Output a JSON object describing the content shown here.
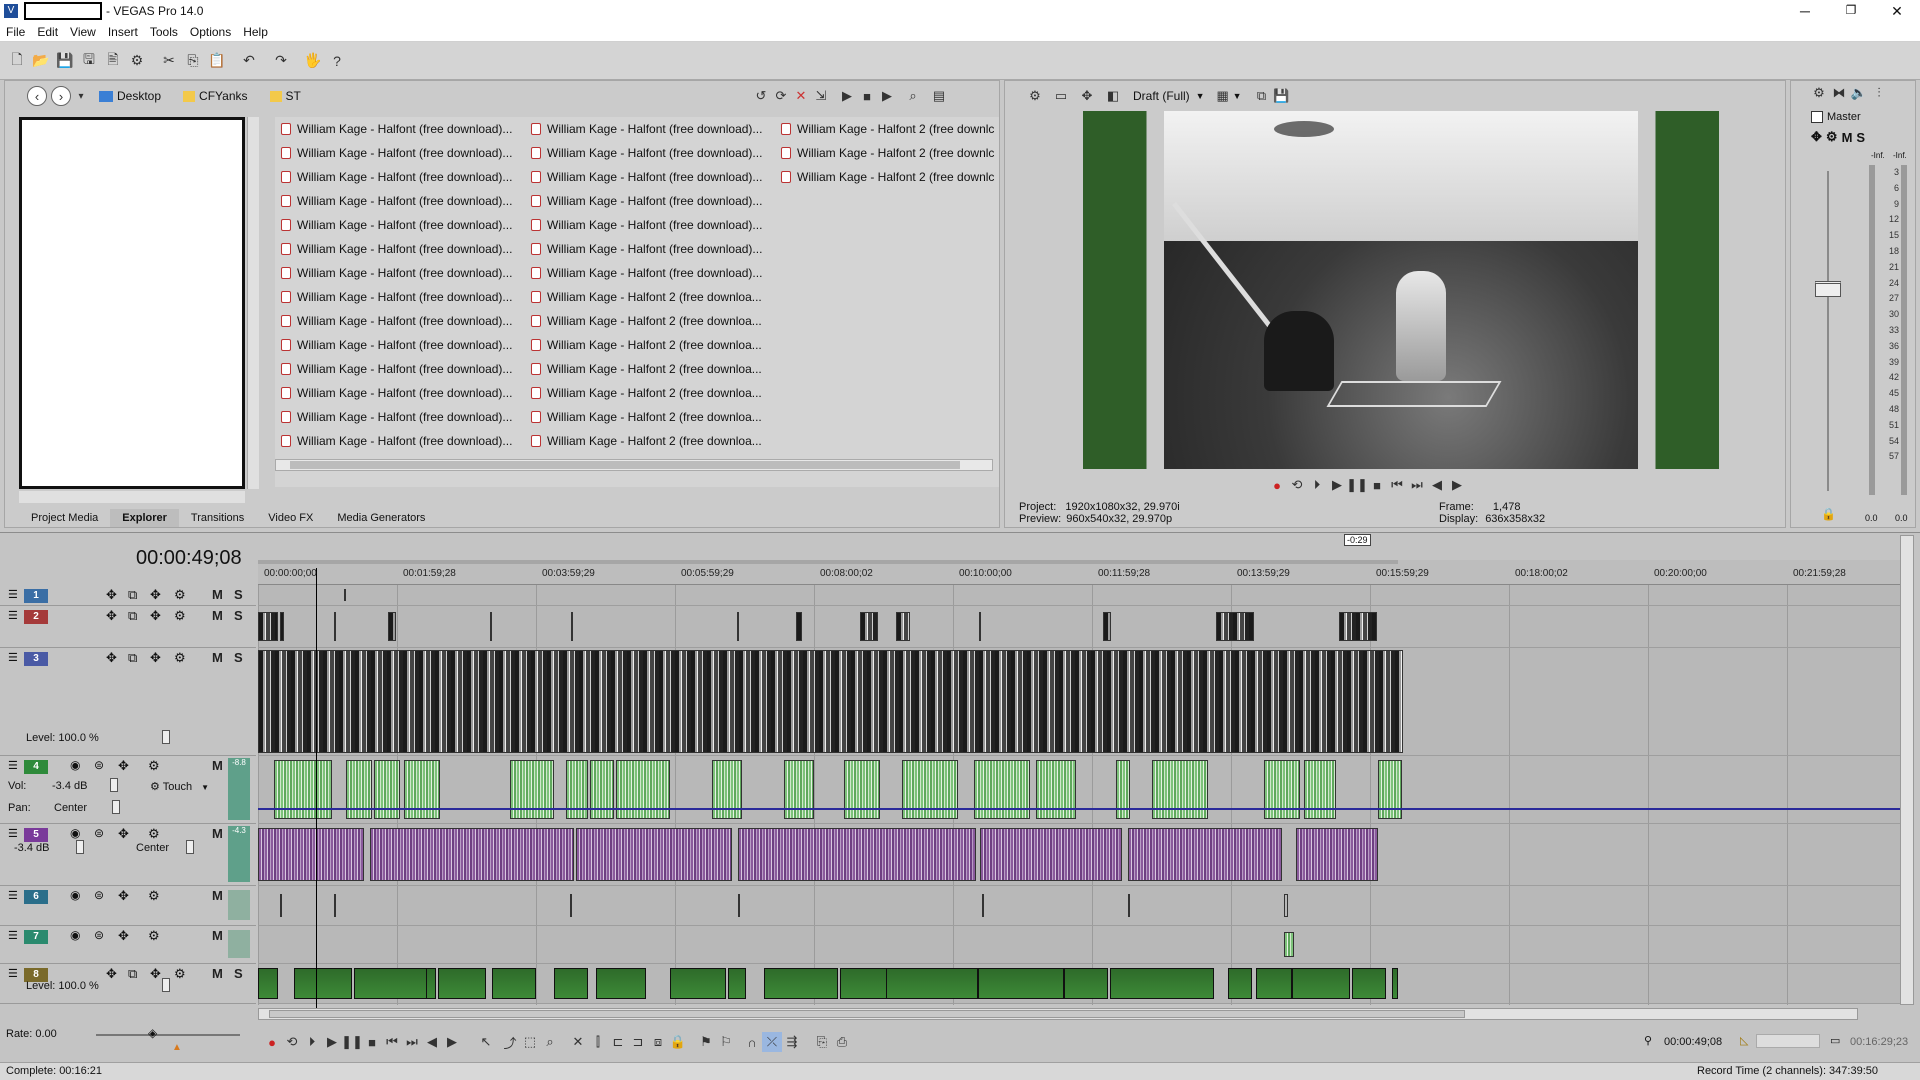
{
  "window": {
    "title": "- VEGAS Pro 14.0"
  },
  "menu": [
    "File",
    "Edit",
    "View",
    "Insert",
    "Tools",
    "Options",
    "Help"
  ],
  "explorer": {
    "breadcrumb": [
      "Desktop",
      "CFYanks",
      "ST"
    ],
    "col1": [
      "William Kage - Halfont (free download)...",
      "William Kage - Halfont (free download)...",
      "William Kage - Halfont (free download)...",
      "William Kage - Halfont (free download)...",
      "William Kage - Halfont (free download)...",
      "William Kage - Halfont (free download)...",
      "William Kage - Halfont (free download)...",
      "William Kage - Halfont (free download)...",
      "William Kage - Halfont (free download)...",
      "William Kage - Halfont (free download)...",
      "William Kage - Halfont (free download)...",
      "William Kage - Halfont (free download)...",
      "William Kage - Halfont (free download)...",
      "William Kage - Halfont (free download)..."
    ],
    "col2": [
      "William Kage - Halfont (free download)...",
      "William Kage - Halfont (free download)...",
      "William Kage - Halfont (free download)...",
      "William Kage - Halfont (free download)...",
      "William Kage - Halfont (free download)...",
      "William Kage - Halfont (free download)...",
      "William Kage - Halfont (free download)...",
      "William Kage - Halfont 2 (free downloa...",
      "William Kage - Halfont 2 (free downloa...",
      "William Kage - Halfont 2 (free downloa...",
      "William Kage - Halfont 2 (free downloa...",
      "William Kage - Halfont 2 (free downloa...",
      "William Kage - Halfont 2 (free downloa...",
      "William Kage - Halfont 2 (free downloa..."
    ],
    "col3": [
      "William Kage - Halfont 2 (free downlc",
      "William Kage - Halfont 2 (free downlc",
      "William Kage - Halfont 2 (free downlc"
    ],
    "tabs": [
      "Project Media",
      "Explorer",
      "Transitions",
      "Video FX",
      "Media Generators"
    ],
    "active_tab": "Explorer"
  },
  "preview": {
    "quality": "Draft (Full)",
    "project_label": "Project:",
    "project_value": "1920x1080x32, 29.970i",
    "preview_label": "Preview:",
    "preview_value": "960x540x32, 29.970p",
    "frame_label": "Frame:",
    "frame_value": "1,478",
    "display_label": "Display:",
    "display_value": "636x358x32"
  },
  "master": {
    "title": "Master",
    "left_peak": "-Inf.",
    "right_peak": "-Inf.",
    "scale": [
      "3",
      "6",
      "9",
      "12",
      "15",
      "18",
      "21",
      "24",
      "27",
      "30",
      "33",
      "36",
      "39",
      "42",
      "45",
      "48",
      "51",
      "54",
      "57"
    ],
    "left_bottom": "0.0",
    "right_bottom": "0.0"
  },
  "timeline": {
    "timecode": "00:00:49;08",
    "ruler": [
      "00:00:00;00",
      "00:01:59;28",
      "00:03:59;29",
      "00:05:59;29",
      "00:08:00;02",
      "00:10:00;00",
      "00:11:59;28",
      "00:13:59;29",
      "00:15:59;29",
      "00:18:00;02",
      "00:20:00;00",
      "00:21:59;28"
    ],
    "marker": "-0:29",
    "tracks": [
      {
        "num": "1",
        "color": "#3a6ea5",
        "type": "video"
      },
      {
        "num": "2",
        "color": "#a53a3a",
        "type": "video"
      },
      {
        "num": "3",
        "color": "#4a5aa5",
        "type": "video",
        "level": "Level: 100.0 %"
      },
      {
        "num": "4",
        "color": "#2e8a3a",
        "type": "audio",
        "vol": "Vol:",
        "vol_val": "-3.4 dB",
        "touch": "Touch",
        "pan": "Pan:",
        "pan_val": "Center",
        "peak": "-8.8"
      },
      {
        "num": "5",
        "color": "#7a3a9a",
        "type": "audio",
        "vol_val": "-3.4 dB",
        "pan_val": "Center",
        "peak": "-4.3"
      },
      {
        "num": "6",
        "color": "#2a6e8a",
        "type": "audio"
      },
      {
        "num": "7",
        "color": "#2a8a6e",
        "type": "audio"
      },
      {
        "num": "8",
        "color": "#7a6a2a",
        "type": "video",
        "level": "Level: 100.0 %"
      }
    ]
  },
  "transport": {
    "rate": "Rate: 0.00",
    "cursor_time": "00:00:49;08",
    "end_time": "00:16:29;23"
  },
  "status": {
    "complete": "Complete: 00:16:21",
    "record_time": "Record Time (2 channels): 347:39:50"
  },
  "colors": {
    "accent": "#3a6ea5",
    "audio_green": "#7dc27a",
    "audio_purple": "#8a5a9c",
    "envelope": "#2a2a9a"
  }
}
